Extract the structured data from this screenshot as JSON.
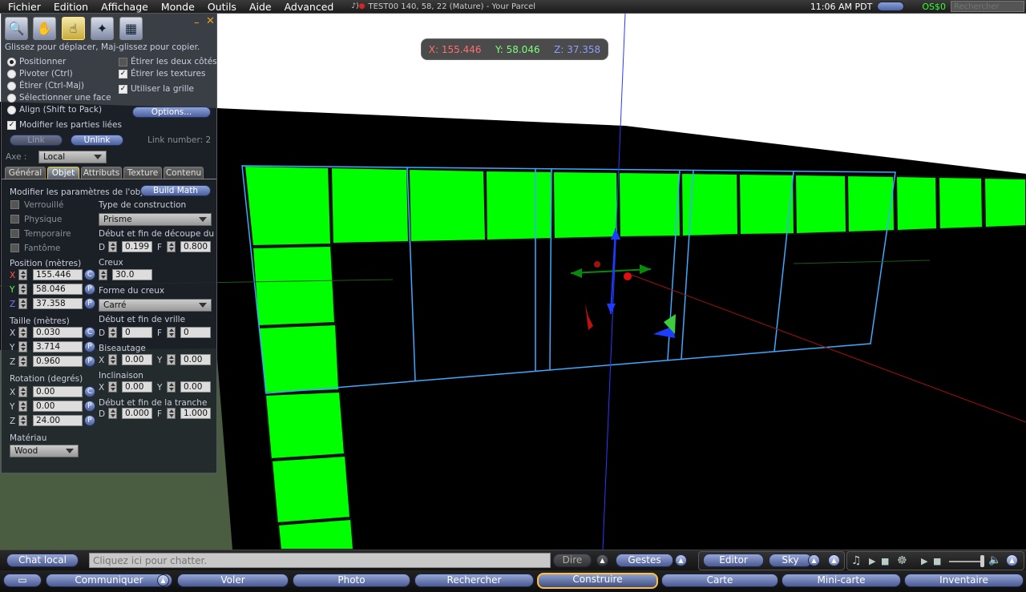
{
  "menubar": {
    "items": [
      "Fichier",
      "Edition",
      "Affichage",
      "Monde",
      "Outils",
      "Aide",
      "Advanced"
    ],
    "parcel": "TEST00 140, 58, 22 (Mature) - Your Parcel",
    "clock": "11:06 AM PDT",
    "balance": "OS$0",
    "search_placeholder": "Rechercher"
  },
  "coords": {
    "x": "X: 155.446",
    "y": "Y: 58.046",
    "z": "Z: 37.358"
  },
  "build": {
    "tools": [
      "zoom-tool-icon",
      "grab-hand-tool-icon",
      "select-tool-icon",
      "create-wand-tool-icon",
      "land-tool-icon"
    ],
    "hint": "Glissez pour déplacer, Maj-glissez pour copier.",
    "modes": [
      "Positionner",
      "Pivoter (Ctrl)",
      "Étirer (Ctrl-Maj)",
      "Sélectionner une face",
      "Align (Shift to Pack)"
    ],
    "selected_mode": 0,
    "stretch_both": "Étirer les deux côtés",
    "stretch_textures": "Étirer les textures",
    "use_grid": "Utiliser la grille",
    "options": "Options...",
    "edit_linked": "Modifier les parties liées",
    "link": "Link",
    "unlink": "Unlink",
    "link_number": "Link number: 2",
    "axis_label": "Axe :",
    "axis_value": "Local",
    "tabs": [
      "Général",
      "Objet",
      "Attributs",
      "Texture",
      "Contenu"
    ],
    "active_tab": 1,
    "modify_label": "Modifier les paramètres de l'obj",
    "build_math": "Build Math",
    "flags": [
      "Verrouillé",
      "Physique",
      "Temporaire",
      "Fantôme"
    ],
    "position_label": "Position (mètres)",
    "position": {
      "x": "155.446",
      "y": "58.046",
      "z": "37.358"
    },
    "size_label": "Taille (mètres)",
    "size": {
      "x": "0.030",
      "y": "3.714",
      "z": "0.960"
    },
    "rotation_label": "Rotation (degrés)",
    "rotation": {
      "x": "0.00",
      "y": "0.00",
      "z": "24.00"
    },
    "material_label": "Matériau",
    "material": "Wood",
    "construction_label": "Type de construction",
    "construction": "Prisme",
    "cut_label": "Début et fin de découpe du",
    "cut": {
      "d": "0.199",
      "f": "0.800"
    },
    "hollow_label": "Creux",
    "hollow": "30.0",
    "hollow_shape_label": "Forme du creux",
    "hollow_shape": "Carré",
    "twist_label": "Début et fin de vrille",
    "twist": {
      "d": "0",
      "f": "0"
    },
    "taper_label": "Biseautage",
    "taper": {
      "x": "0.00",
      "y": "0.00"
    },
    "shear_label": "Inclinaison",
    "shear": {
      "x": "0.00",
      "y": "0.00"
    },
    "slice_label": "Début et fin de la tranche",
    "slice": {
      "d": "0.000",
      "f": "1.000"
    },
    "letters": {
      "x": "X",
      "y": "Y",
      "z": "Z",
      "d": "D",
      "f": "F",
      "c": "C",
      "p": "P"
    }
  },
  "chatbar": {
    "local_chat": "Chat local",
    "placeholder": "Cliquez ici pour chatter.",
    "say": "Dire",
    "gestures": "Gestes",
    "editor": "Editor",
    "sky": "Sky"
  },
  "toolbar": {
    "communicate": "Communiquer",
    "fly": "Voler",
    "photo": "Photo",
    "search": "Rechercher",
    "build": "Construire",
    "map": "Carte",
    "minimap": "Mini-carte",
    "inventory": "Inventaire"
  },
  "colors": {
    "prim_green": "#00ff00",
    "selection_blue": "#3fa9ff",
    "ui_blue": "#5a6ba8",
    "active_border": "#ffbe3d"
  }
}
